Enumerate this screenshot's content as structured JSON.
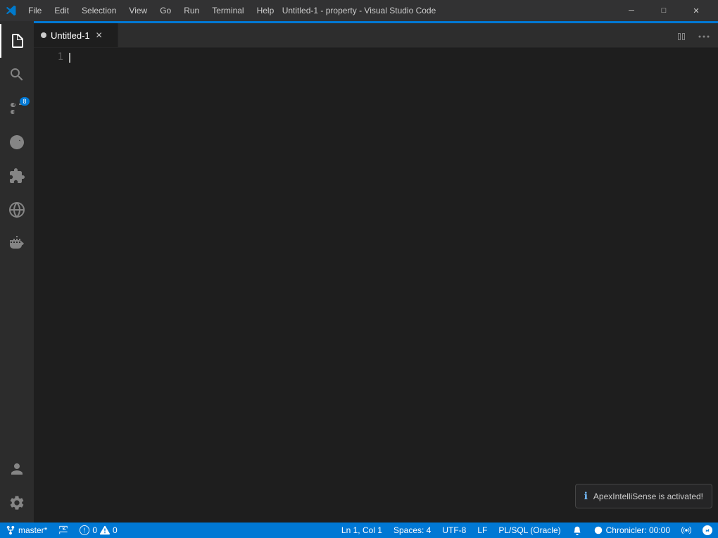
{
  "titlebar": {
    "logo": "vscode",
    "menu_items": [
      "File",
      "Edit",
      "Selection",
      "View",
      "Go",
      "Run",
      "Terminal",
      "Help"
    ],
    "title": "Untitled-1 - property - Visual Studio Code",
    "btn_minimize": "─",
    "btn_maximize": "□",
    "btn_close": "✕"
  },
  "activity_bar": {
    "items": [
      {
        "id": "explorer",
        "icon": "files-icon",
        "active": true
      },
      {
        "id": "search",
        "icon": "search-icon",
        "active": false
      },
      {
        "id": "source-control",
        "icon": "source-control-icon",
        "active": false,
        "badge": "8"
      },
      {
        "id": "run",
        "icon": "run-icon",
        "active": false
      },
      {
        "id": "extensions",
        "icon": "extensions-icon",
        "active": false
      },
      {
        "id": "remote",
        "icon": "remote-icon",
        "active": false
      },
      {
        "id": "docker",
        "icon": "docker-icon",
        "active": false
      }
    ],
    "bottom_items": [
      {
        "id": "account",
        "icon": "account-icon"
      },
      {
        "id": "settings",
        "icon": "settings-icon"
      }
    ]
  },
  "tabs": {
    "items": [
      {
        "label": "Untitled-1",
        "active": true,
        "modified": false
      }
    ],
    "split_icon": "split-editor-icon",
    "more_icon": "more-icon"
  },
  "editor": {
    "line_numbers": [
      "1"
    ],
    "cursor_line": 1
  },
  "notification": {
    "icon": "ℹ",
    "message": "ApexIntelliSense is activated!"
  },
  "status_bar": {
    "branch": "master*",
    "sync_icon": "sync-icon",
    "errors": "0",
    "warnings": "0",
    "ln_col": "Ln 1, Col 1",
    "spaces": "Spaces: 4",
    "encoding": "UTF-8",
    "eol": "LF",
    "language": "PL/SQL (Oracle)",
    "notification_icon": "bell-icon",
    "chronicler": "Chronicler: 00:00",
    "broadcast_icon": "broadcast-icon",
    "remote_icon": "remote-status-icon"
  }
}
